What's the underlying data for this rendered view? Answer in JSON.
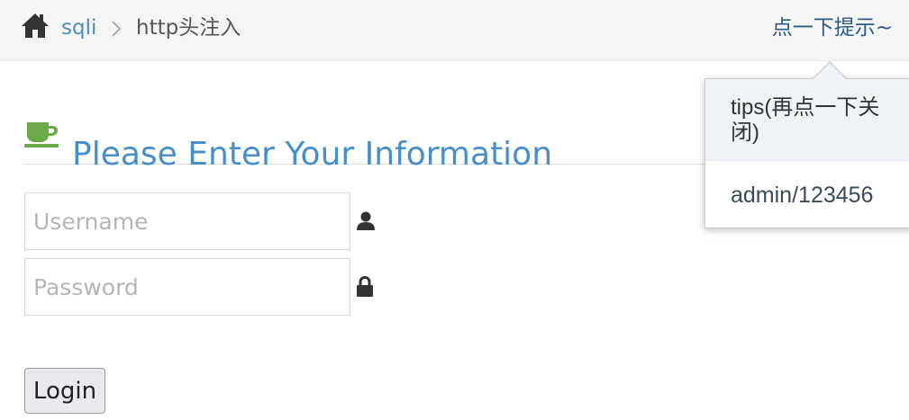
{
  "breadcrumb": {
    "home_icon": "home-icon",
    "link": "sqli",
    "current": "http头注入"
  },
  "tip_link": "点一下提示~",
  "header": {
    "icon": "coffee-icon",
    "title": "Please Enter Your Information"
  },
  "form": {
    "username_placeholder": "Username",
    "password_placeholder": "Password",
    "login_label": "Login"
  },
  "popover": {
    "title": "tips(再点一下关闭)",
    "content": "admin/123456"
  },
  "colors": {
    "link_blue": "#4c8fbd",
    "title_blue": "#478fca",
    "coffee_green": "#69aa46",
    "tip_blue": "#2e5a86"
  }
}
